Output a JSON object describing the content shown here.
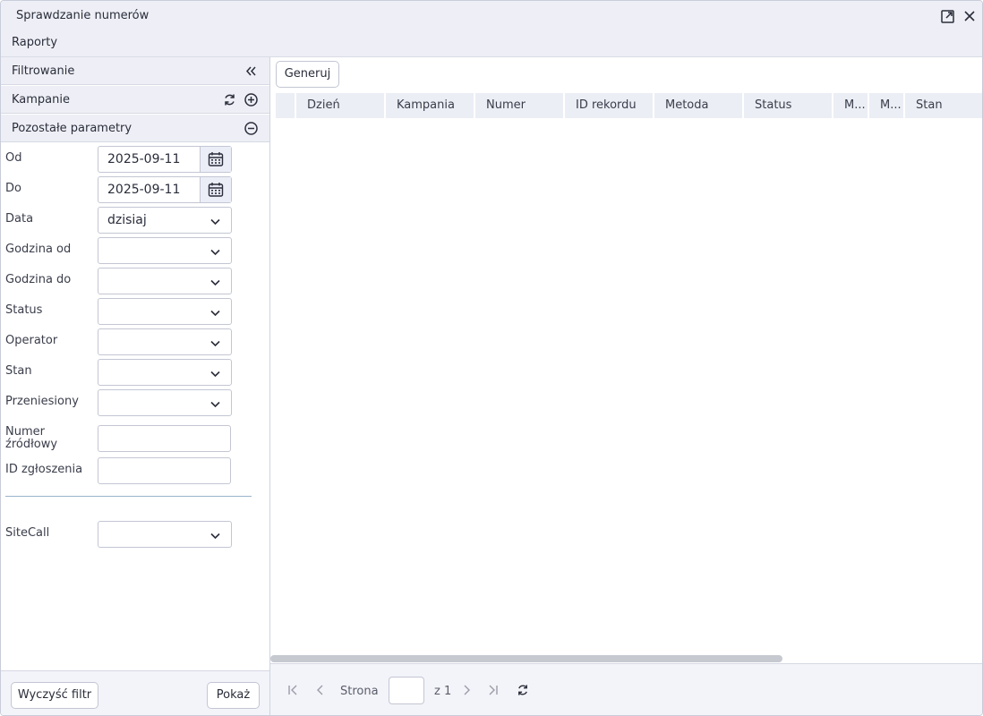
{
  "window": {
    "title": "Sprawdzanie numerów"
  },
  "menu": {
    "reports": "Raporty"
  },
  "left": {
    "filter_title": "Filtrowanie",
    "campaigns_title": "Kampanie",
    "other_params_title": "Pozostałe parametry",
    "fields": {
      "od": {
        "label": "Od",
        "value": "2025-09-11"
      },
      "do": {
        "label": "Do",
        "value": "2025-09-11"
      },
      "data": {
        "label": "Data",
        "value": "dzisiaj"
      },
      "godzina_od": {
        "label": "Godzina od",
        "value": ""
      },
      "godzina_do": {
        "label": "Godzina do",
        "value": ""
      },
      "status": {
        "label": "Status",
        "value": ""
      },
      "operator": {
        "label": "Operator",
        "value": ""
      },
      "stan": {
        "label": "Stan",
        "value": ""
      },
      "przeniesiony": {
        "label": "Przeniesiony",
        "value": ""
      },
      "numer_zrodlowy": {
        "label_line1": "Numer",
        "label_line2": "źródłowy",
        "value": ""
      },
      "id_zgloszenia": {
        "label": "ID zgłoszenia",
        "value": ""
      },
      "sitecall": {
        "label": "SiteCall",
        "value": ""
      }
    },
    "clear_button": "Wyczyść filtr",
    "show_button": "Pokaż"
  },
  "right": {
    "generate_button": "Generuj",
    "columns": [
      "Dzień",
      "Kampania",
      "Numer",
      "ID rekordu",
      "Metoda",
      "Status",
      "M...",
      "M...",
      "Stan"
    ],
    "pager": {
      "page_label": "Strona",
      "page_value": "",
      "of_label": "z 1"
    }
  },
  "colors": {
    "header_bg": "#eeeff6",
    "column_bg": "#eceef5",
    "divider": "#9bb4cc"
  }
}
